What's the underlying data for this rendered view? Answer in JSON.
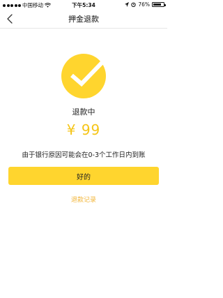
{
  "status_bar": {
    "carrier": "中国移动",
    "time": "下午5:34",
    "battery": "76%"
  },
  "nav": {
    "title": "押金退款"
  },
  "main": {
    "status": "退款中",
    "amount": "¥ 99",
    "note": "由于银行原因可能会在0-3个工作日内到账",
    "ok_label": "好的",
    "history_label": "退款记录"
  },
  "colors": {
    "accent": "#ffd52e",
    "amount": "#f5c518",
    "link": "#f2b63a"
  }
}
